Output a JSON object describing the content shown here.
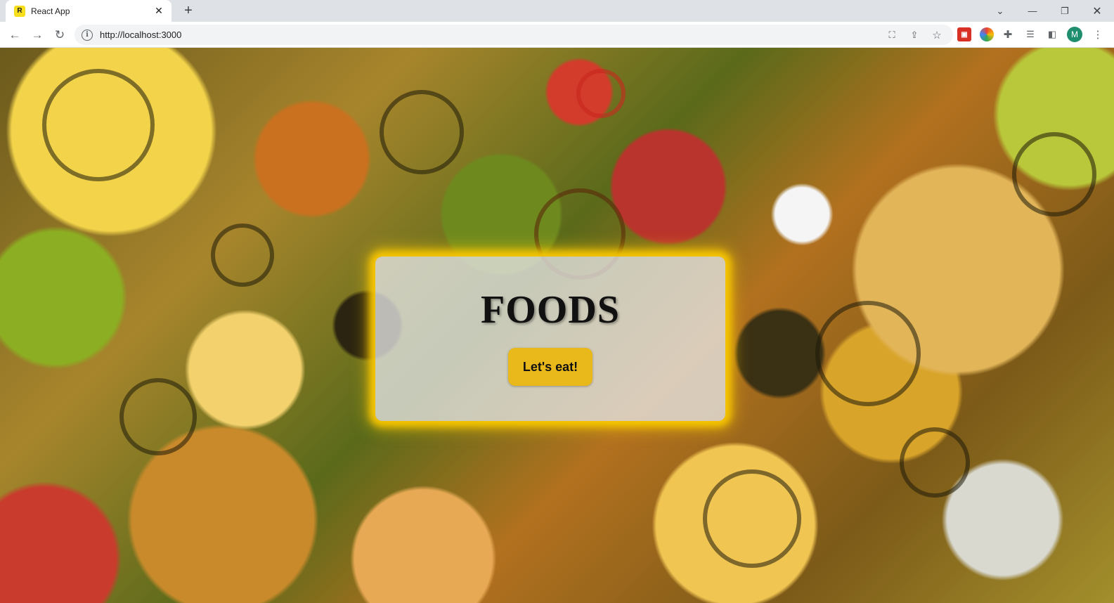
{
  "browser": {
    "tab_title": "React App",
    "favicon_label": "R",
    "url": "http://localhost:3000",
    "avatar_initial": "M",
    "accent": "#1e8e6e"
  },
  "page": {
    "title": "FOODS",
    "cta_label": "Let's eat!",
    "glow_color": "#f5c400",
    "button_color": "#e9b81b"
  }
}
